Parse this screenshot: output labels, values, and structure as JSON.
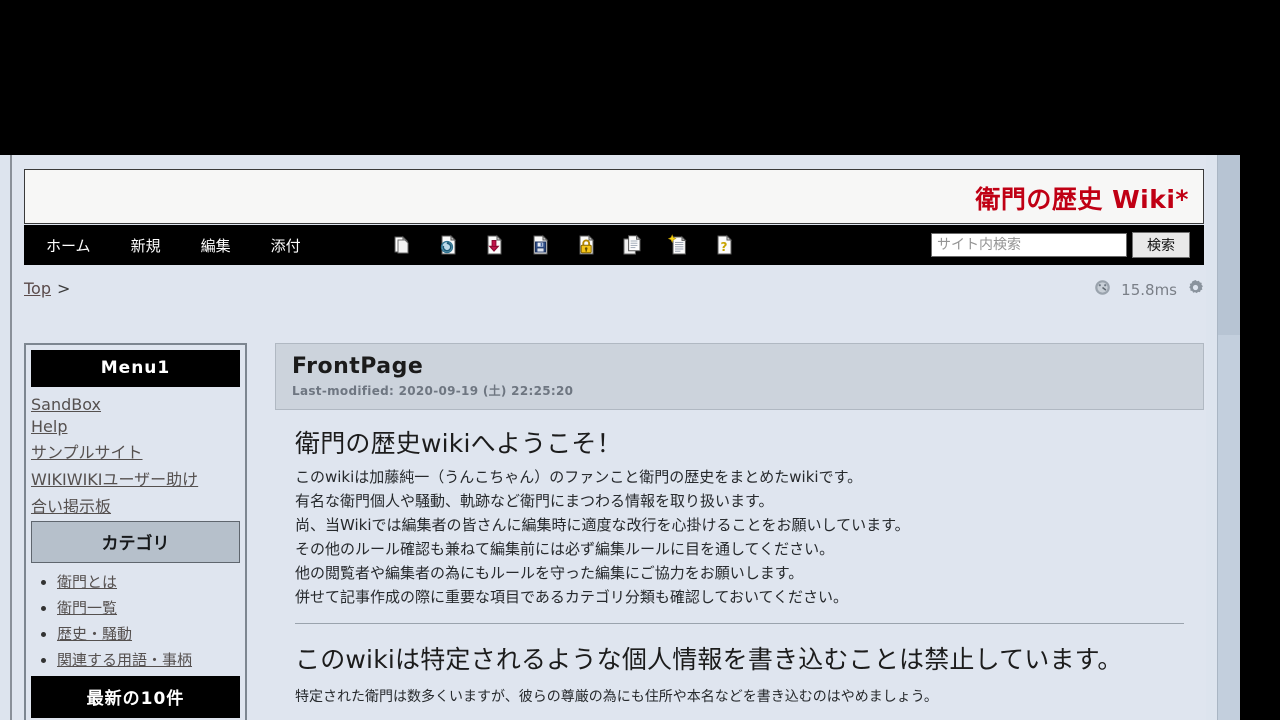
{
  "site": {
    "title": "衛門の歴史 Wiki*"
  },
  "nav": {
    "links": [
      {
        "label": "ホーム",
        "name": "nav-home"
      },
      {
        "label": "新規",
        "name": "nav-new"
      },
      {
        "label": "編集",
        "name": "nav-edit"
      },
      {
        "label": "添付",
        "name": "nav-attach"
      }
    ],
    "icons": [
      {
        "name": "page-copy-icon",
        "title": "複製"
      },
      {
        "name": "page-reload-icon",
        "title": "再読込"
      },
      {
        "name": "page-download-icon",
        "title": "ダウンロード"
      },
      {
        "name": "save-floppy-icon",
        "title": "保存"
      },
      {
        "name": "page-lock-icon",
        "title": "凍結"
      },
      {
        "name": "page-duplicate-icon",
        "title": "複写"
      },
      {
        "name": "page-new-icon",
        "title": "新規作成"
      },
      {
        "name": "help-icon",
        "title": "ヘルプ"
      }
    ]
  },
  "search": {
    "placeholder": "サイト内検索",
    "value": "",
    "button_label": "検索"
  },
  "breadcrumb": {
    "root_label": "Top",
    "separator": ">"
  },
  "status": {
    "load_time": "15.8ms",
    "gauge_icon": "gauge-icon",
    "gear_icon": "gear-icon"
  },
  "sidebar": {
    "menu1": {
      "heading": "Menu1",
      "items": [
        {
          "label": "SandBox"
        },
        {
          "label": "Help"
        },
        {
          "label": "サンプルサイト"
        },
        {
          "label": "WIKIWIKIユーザー助け"
        },
        {
          "label": "合い掲示板"
        }
      ]
    },
    "category": {
      "heading": "カテゴリ",
      "items": [
        {
          "label": "衛門とは"
        },
        {
          "label": "衛門一覧"
        },
        {
          "label": "歴史・騒動"
        },
        {
          "label": "関連する用語・事柄"
        }
      ]
    },
    "recent": {
      "heading": "最新の10件"
    }
  },
  "page": {
    "title": "FrontPage",
    "last_modified": "Last-modified: 2020-09-19 (土) 22:25:20",
    "section1": {
      "heading": "衛門の歴史wikiへようこそ！",
      "paragraphs": [
        "このwikiは加藤純一（うんこちゃん）のファンこと衛門の歴史をまとめたwikiです。",
        "有名な衛門個人や騒動、軌跡など衛門にまつわる情報を取り扱います。",
        "尚、当Wikiでは編集者の皆さんに編集時に適度な改行を心掛けることをお願いしています。",
        "その他のルール確認も兼ねて編集前には必ず編集ルールに目を通してください。",
        "他の閲覧者や編集者の為にもルールを守った編集にご協力をお願いします。",
        "併せて記事作成の際に重要な項目であるカテゴリ分類も確認しておいてください。"
      ]
    },
    "section2": {
      "heading": "このwikiは特定されるような個人情報を書き込むことは禁止しています。",
      "paragraph": "特定された衛門は数多くいますが、彼らの尊厳の為にも住所や本名などを書き込むのはやめましょう。"
    }
  },
  "colors": {
    "brand_red": "#c00014",
    "nav_bg": "#000000",
    "page_bg": "#dfe5ef",
    "title_box_bg": "#ccd3dc",
    "panel_gray": "#b6c0cb"
  }
}
